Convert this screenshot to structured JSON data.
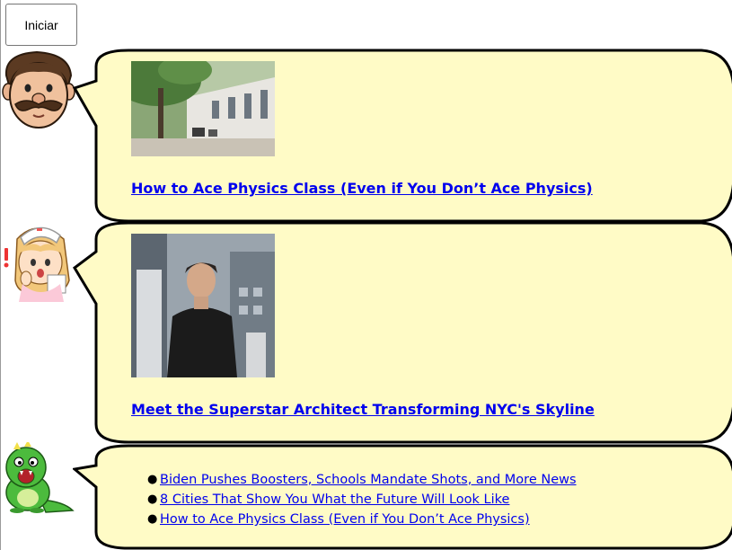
{
  "toolbar": {
    "start_label": "Iniciar"
  },
  "colors": {
    "bubble_fill": "#fffbc6",
    "bubble_stroke": "#000000",
    "link": "#0000ee"
  },
  "messages": [
    {
      "avatar": "mustache-man-icon",
      "thumbnail": "campus-courtyard-photo",
      "headline": "How to Ace Physics Class (Even if You Don’t Ace Physics)"
    },
    {
      "avatar": "surprised-nurse-icon",
      "thumbnail": "architect-portrait-photo",
      "headline": "Meet the Superstar Architect Transforming NYC's Skyline"
    },
    {
      "avatar": "green-dinosaur-icon",
      "links": [
        "Biden Pushes Boosters, Schools Mandate Shots, and More News",
        "8 Cities That Show You What the Future Will Look Like",
        "How to Ace Physics Class (Even if You Don’t Ace Physics)"
      ]
    }
  ]
}
